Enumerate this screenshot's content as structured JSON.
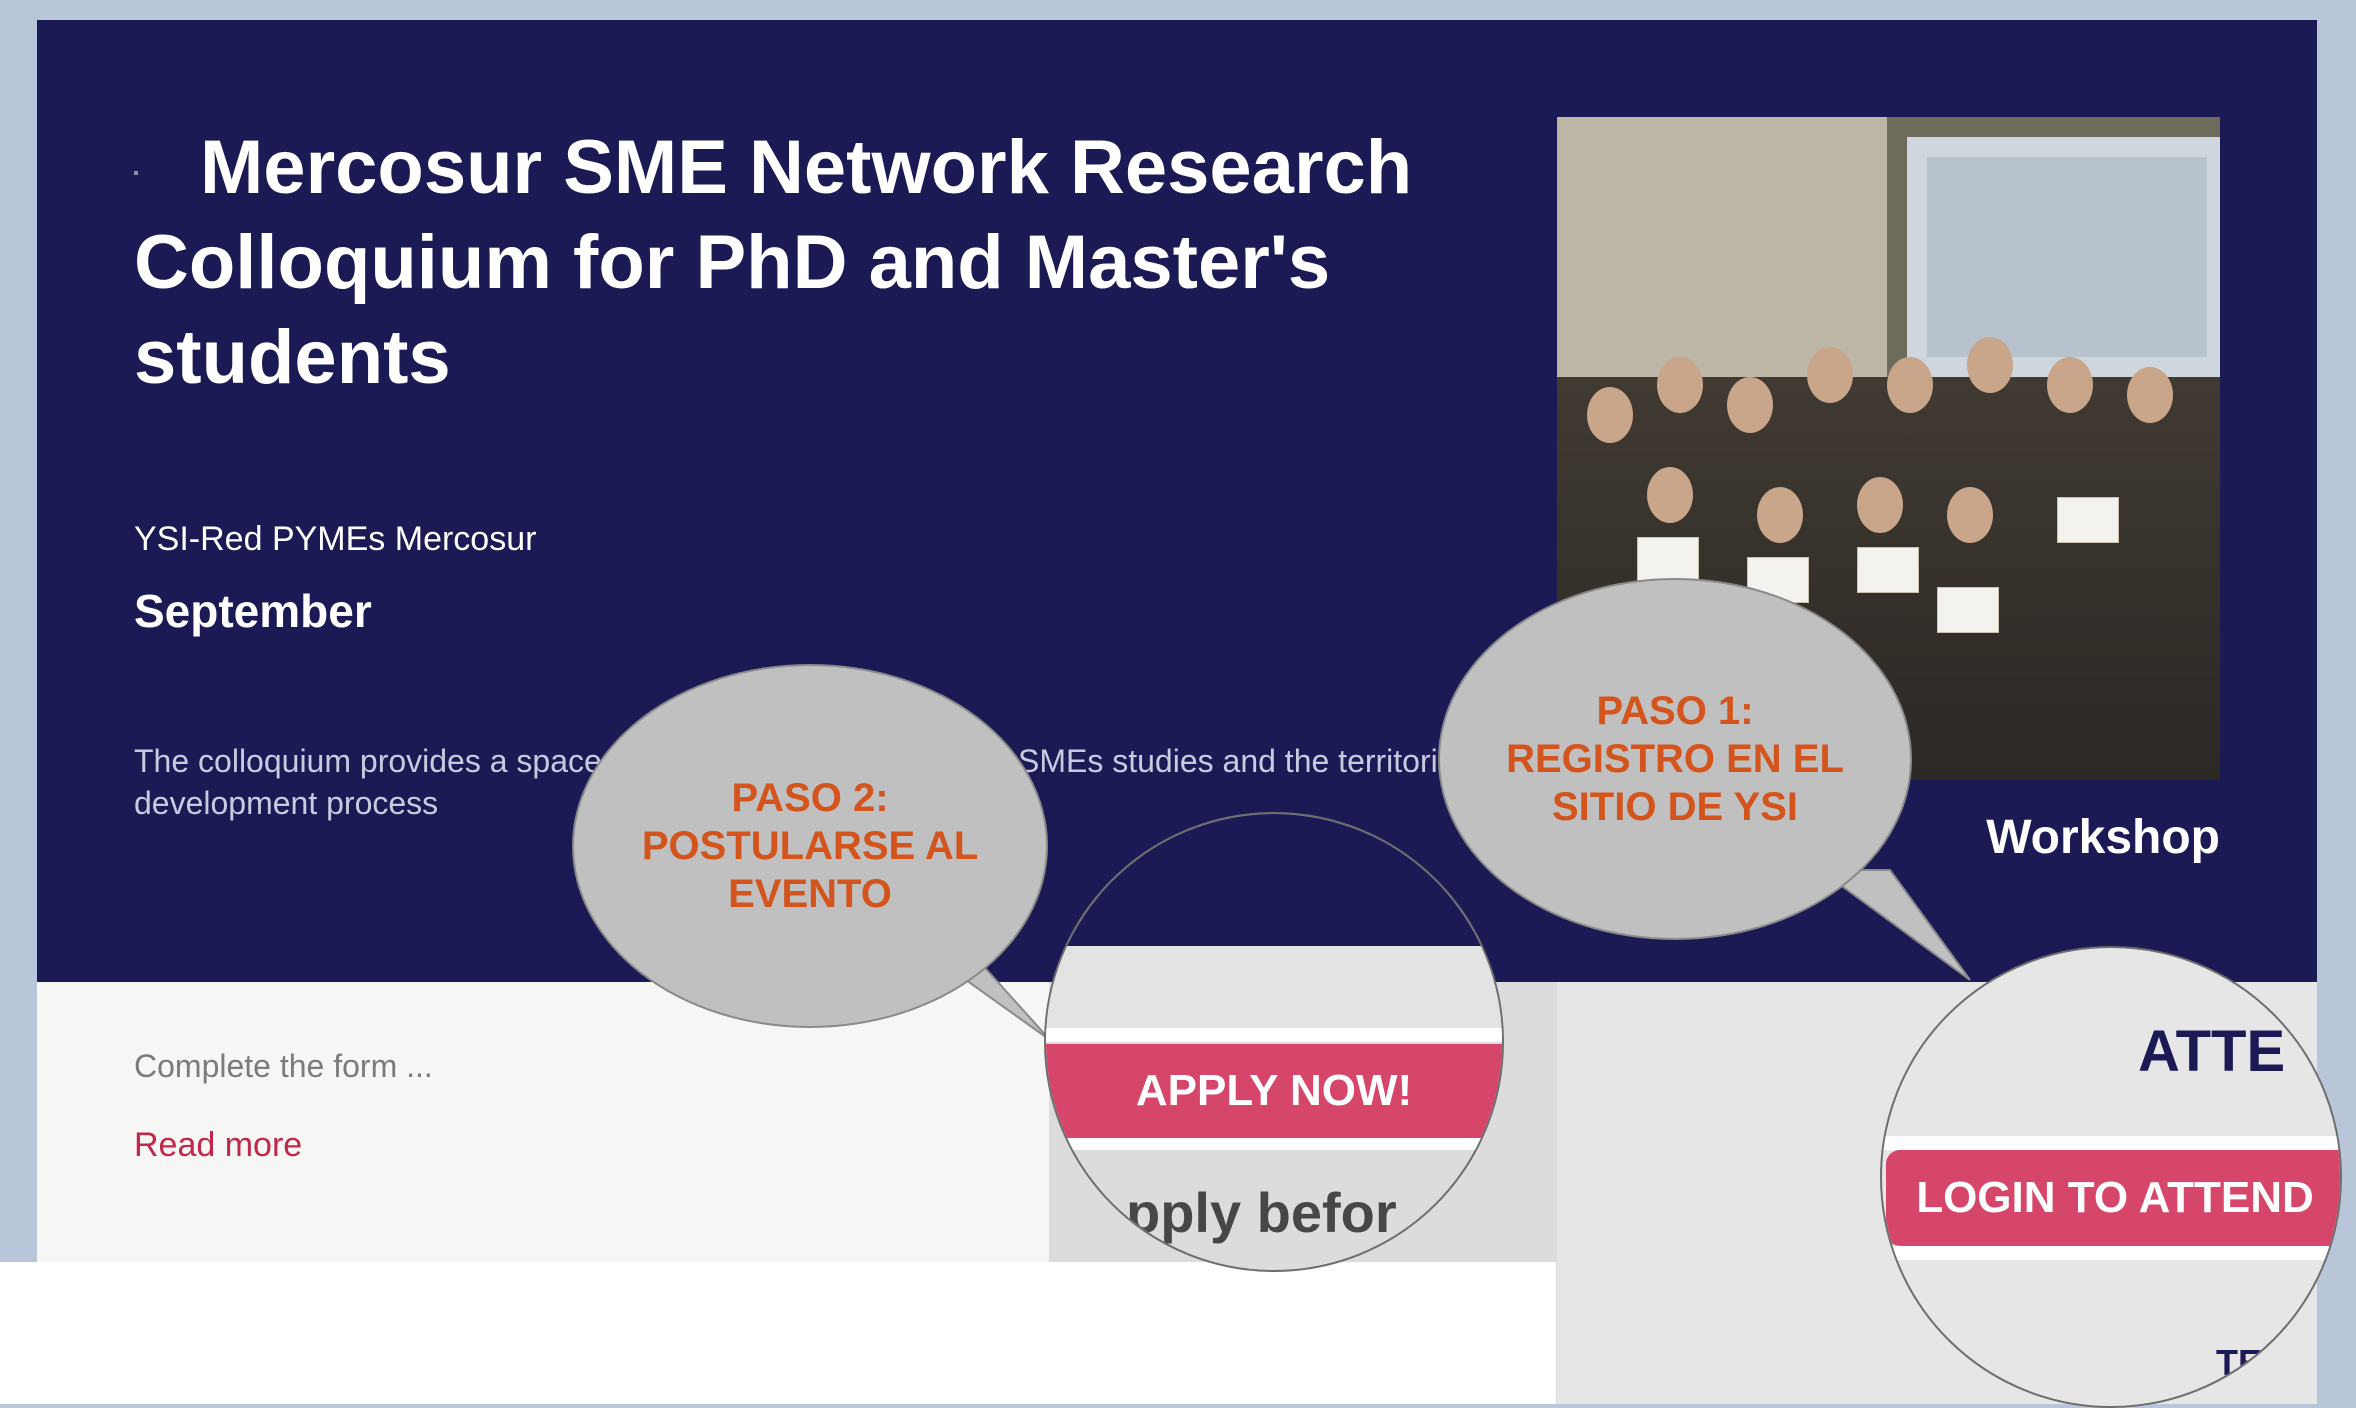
{
  "event": {
    "title": "Mercosur SME Network Research Colloquium for PhD and Master's students",
    "organizer": "YSI-Red PYMEs Mercosur",
    "month": "September",
    "description": "The colloquium provides a space for researchers interested in SMEs studies and the territorial development process",
    "category": "Workshop"
  },
  "summary": {
    "form_text": "Complete the form ...",
    "read_more": "Read more"
  },
  "callouts": {
    "step2": "PASO 2:\nPOSTULARSE AL\nEVENTO",
    "step1": "PASO 1:\nREGISTRO EN EL\nSITIO DE YSI"
  },
  "zoom_apply": {
    "button_label": "APPLY NOW!",
    "deadline_fragment": "pply befor"
  },
  "zoom_login": {
    "heading_fragment": "ATTE",
    "button_label": "LOGIN TO ATTEND",
    "footer_fragment": "TE"
  },
  "colors": {
    "hero_bg": "#1b1a55",
    "accent": "#d6456a",
    "callout_text": "#d3541c"
  }
}
